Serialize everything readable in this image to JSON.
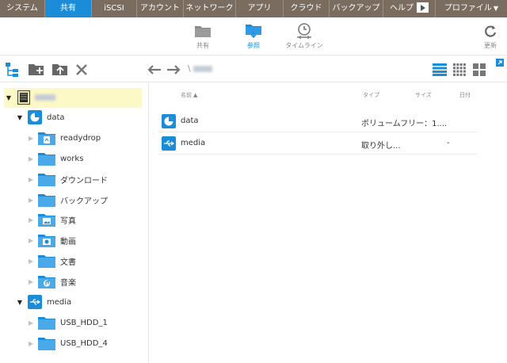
{
  "topnav": {
    "tabs": [
      {
        "label": "システム"
      },
      {
        "label": "共有"
      },
      {
        "label": "iSCSI"
      },
      {
        "label": "アカウント"
      },
      {
        "label": "ネットワーク"
      },
      {
        "label": "アプリ"
      },
      {
        "label": "クラウド"
      },
      {
        "label": "バックアップ"
      },
      {
        "label": "ヘルプ"
      },
      {
        "label": "プロファイル"
      }
    ],
    "active_color": "#1a8cd8",
    "bg_color": "#7a6d60"
  },
  "subnav": {
    "shares_label": "共有",
    "browse_label": "参照",
    "timeline_label": "タイムライン",
    "refresh_label": "更新"
  },
  "toolbar": {
    "path_separator": "\\"
  },
  "tree": {
    "root": {
      "label": ""
    },
    "volumes": [
      {
        "label": "data",
        "icon": "volume-icon",
        "children": [
          {
            "label": "readydrop",
            "icon": "readydrop-folder-icon"
          },
          {
            "label": "works",
            "icon": "folder-icon"
          },
          {
            "label": "ダウンロード",
            "icon": "folder-icon"
          },
          {
            "label": "バックアップ",
            "icon": "folder-icon"
          },
          {
            "label": "写真",
            "icon": "photo-folder-icon"
          },
          {
            "label": "動画",
            "icon": "video-folder-icon"
          },
          {
            "label": "文書",
            "icon": "folder-icon"
          },
          {
            "label": "音楽",
            "icon": "music-folder-icon"
          }
        ]
      },
      {
        "label": "media",
        "icon": "usb-icon",
        "children": [
          {
            "label": "USB_HDD_1",
            "icon": "folder-icon"
          },
          {
            "label": "USB_HDD_4",
            "icon": "folder-icon"
          }
        ]
      }
    ]
  },
  "list": {
    "headers": {
      "name": "名前",
      "type": "タイプ",
      "size": "サイズ",
      "date": "日付"
    },
    "rows": [
      {
        "name": "data",
        "type": "ボリュームフリー：1....",
        "size": "",
        "date": "",
        "icon": "volume-icon"
      },
      {
        "name": "media",
        "type": "取り外し...",
        "size": "",
        "date": "-",
        "icon": "usb-icon"
      }
    ]
  }
}
